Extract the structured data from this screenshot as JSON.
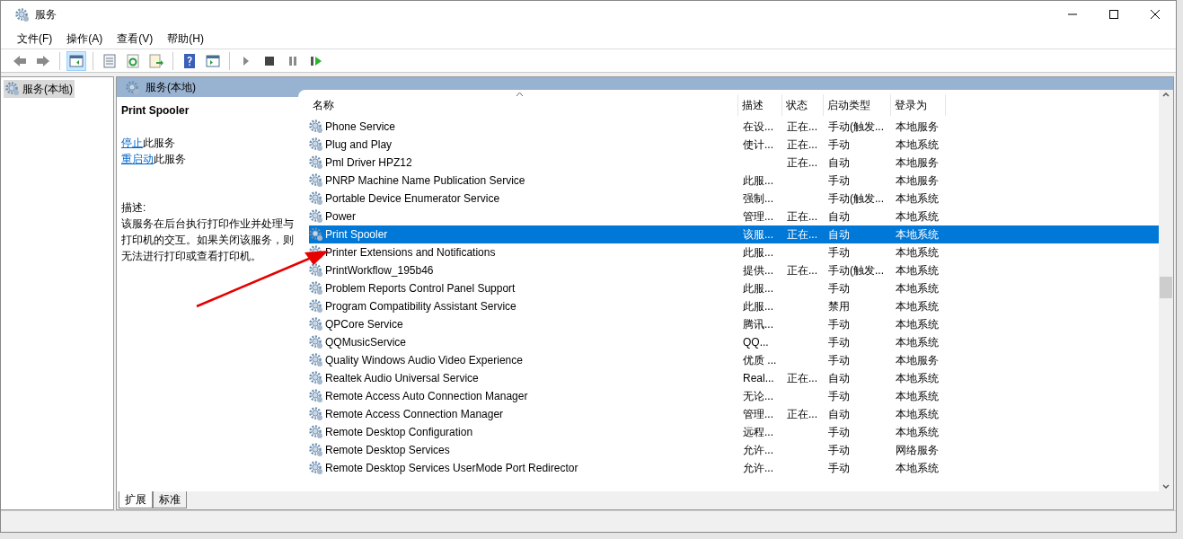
{
  "window": {
    "title": "服务"
  },
  "menu": [
    "文件(F)",
    "操作(A)",
    "查看(V)",
    "帮助(H)"
  ],
  "tree": [
    {
      "label": "服务(本地)",
      "selected": true
    }
  ],
  "pane_header": "服务(本地)",
  "detail": {
    "title": "Print Spooler",
    "actions": [
      {
        "link": "停止",
        "text": "此服务"
      },
      {
        "link": "重启动",
        "text": "此服务"
      }
    ],
    "description_label": "描述:",
    "description": "该服务在后台执行打印作业并处理与打印机的交互。如果关闭该服务，则无法进行打印或查看打印机。"
  },
  "table": {
    "columns": [
      "名称",
      "描述",
      "状态",
      "启动类型",
      "登录为"
    ],
    "rows": [
      {
        "name": "Phone Service",
        "description": "在设...",
        "status": "正在...",
        "startup": "手动(触发...",
        "logon": "本地服务",
        "selected": false
      },
      {
        "name": "Plug and Play",
        "description": "使计...",
        "status": "正在...",
        "startup": "手动",
        "logon": "本地系统",
        "selected": false
      },
      {
        "name": "Pml Driver HPZ12",
        "description": "",
        "status": "正在...",
        "startup": "自动",
        "logon": "本地服务",
        "selected": false
      },
      {
        "name": "PNRP Machine Name Publication Service",
        "description": "此服...",
        "status": "",
        "startup": "手动",
        "logon": "本地服务",
        "selected": false
      },
      {
        "name": "Portable Device Enumerator Service",
        "description": "强制...",
        "status": "",
        "startup": "手动(触发...",
        "logon": "本地系统",
        "selected": false
      },
      {
        "name": "Power",
        "description": "管理...",
        "status": "正在...",
        "startup": "自动",
        "logon": "本地系统",
        "selected": false
      },
      {
        "name": "Print Spooler",
        "description": "该服...",
        "status": "正在...",
        "startup": "自动",
        "logon": "本地系统",
        "selected": true
      },
      {
        "name": "Printer Extensions and Notifications",
        "description": "此服...",
        "status": "",
        "startup": "手动",
        "logon": "本地系统",
        "selected": false
      },
      {
        "name": "PrintWorkflow_195b46",
        "description": "提供...",
        "status": "正在...",
        "startup": "手动(触发...",
        "logon": "本地系统",
        "selected": false
      },
      {
        "name": "Problem Reports Control Panel Support",
        "description": "此服...",
        "status": "",
        "startup": "手动",
        "logon": "本地系统",
        "selected": false
      },
      {
        "name": "Program Compatibility Assistant Service",
        "description": "此服...",
        "status": "",
        "startup": "禁用",
        "logon": "本地系统",
        "selected": false
      },
      {
        "name": "QPCore Service",
        "description": "腾讯...",
        "status": "",
        "startup": "手动",
        "logon": "本地系统",
        "selected": false
      },
      {
        "name": "QQMusicService",
        "description": "QQ...",
        "status": "",
        "startup": "手动",
        "logon": "本地系统",
        "selected": false
      },
      {
        "name": "Quality Windows Audio Video Experience",
        "description": "优质 ...",
        "status": "",
        "startup": "手动",
        "logon": "本地服务",
        "selected": false
      },
      {
        "name": "Realtek Audio Universal Service",
        "description": "Real...",
        "status": "正在...",
        "startup": "自动",
        "logon": "本地系统",
        "selected": false
      },
      {
        "name": "Remote Access Auto Connection Manager",
        "description": "无论...",
        "status": "",
        "startup": "手动",
        "logon": "本地系统",
        "selected": false
      },
      {
        "name": "Remote Access Connection Manager",
        "description": "管理...",
        "status": "正在...",
        "startup": "自动",
        "logon": "本地系统",
        "selected": false
      },
      {
        "name": "Remote Desktop Configuration",
        "description": "远程...",
        "status": "",
        "startup": "手动",
        "logon": "本地系统",
        "selected": false
      },
      {
        "name": "Remote Desktop Services",
        "description": "允许...",
        "status": "",
        "startup": "手动",
        "logon": "网络服务",
        "selected": false
      },
      {
        "name": "Remote Desktop Services UserMode Port Redirector",
        "description": "允许...",
        "status": "",
        "startup": "手动",
        "logon": "本地系统",
        "selected": false
      }
    ]
  },
  "tabs": [
    {
      "label": "扩展",
      "selected": true
    },
    {
      "label": "标准",
      "selected": false
    }
  ]
}
